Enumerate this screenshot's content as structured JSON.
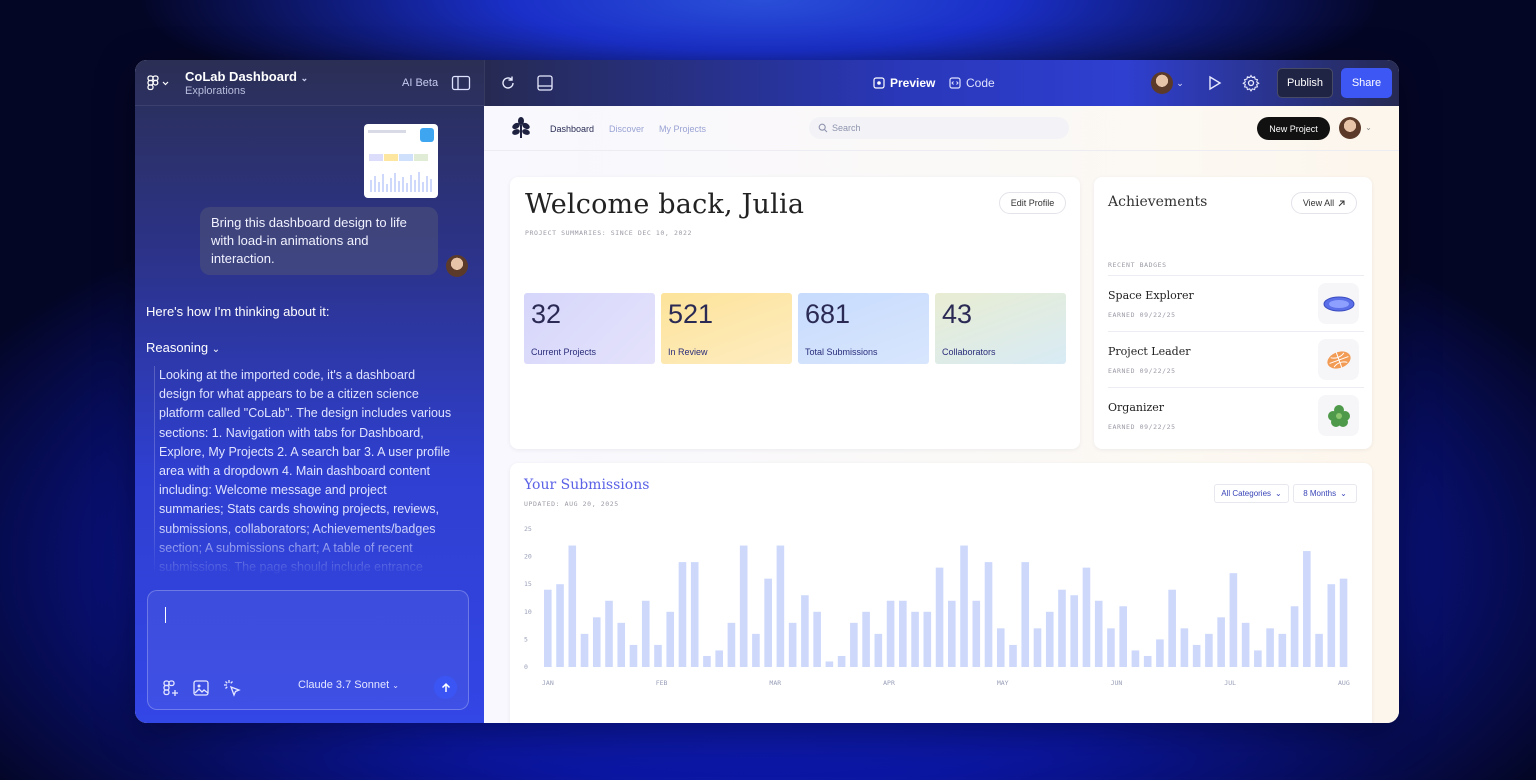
{
  "editor": {
    "project_title": "CoLab Dashboard",
    "project_subtitle": "Explorations",
    "ai_beta": "AI Beta",
    "tabs": {
      "preview": "Preview",
      "code": "Code"
    },
    "publish": "Publish",
    "share": "Share"
  },
  "chat": {
    "user_message": "Bring this dashboard design to life with load-in animations and interaction.",
    "assistant_intro": "Here's how I'm thinking about it:",
    "reasoning_label": "Reasoning",
    "reasoning_text": "Looking at the imported code, it's a dashboard design for what appears to be a citizen science platform called \"CoLab\". The design includes various sections: 1. Navigation with tabs for Dashboard, Explore, My Projects 2. A search bar 3. A user profile area with a dropdown 4. Main dashboard content including: Welcome message and project summaries; Stats cards showing projects, reviews, submissions, collaborators; Achievements/badges section; A submissions chart; A table of recent submissions. The page should include entrance animations and interactive states.",
    "model": "Claude 3.7 Sonnet"
  },
  "preview": {
    "nav": {
      "dashboard": "Dashboard",
      "discover": "Discover",
      "my_projects": "My Projects"
    },
    "search_placeholder": "Search",
    "new_project": "New Project",
    "welcome": "Welcome back, Julia",
    "summary_caption": "PROJECT SUMMARIES: SINCE DEC 10, 2022",
    "edit_profile": "Edit Profile",
    "stats": [
      {
        "value": "32",
        "label": "Current Projects"
      },
      {
        "value": "521",
        "label": "In Review"
      },
      {
        "value": "681",
        "label": "Total Submissions"
      },
      {
        "value": "43",
        "label": "Collaborators"
      }
    ],
    "achievements": {
      "title": "Achievements",
      "view_all": "View All",
      "recent_label": "RECENT BADGES",
      "badges": [
        {
          "name": "Space Explorer",
          "earned": "EARNED 09/22/25"
        },
        {
          "name": "Project Leader",
          "earned": "EARNED 09/22/25"
        },
        {
          "name": "Organizer",
          "earned": "EARNED 09/22/25"
        }
      ]
    },
    "submissions": {
      "title": "Your Submissions",
      "updated": "UPDATED: AUG 20, 2025",
      "category_filter": "All Categories",
      "range_filter": "8 Months"
    }
  },
  "chart_data": {
    "type": "bar",
    "ylim": [
      0,
      25
    ],
    "yticks": [
      "25",
      "20",
      "15",
      "10",
      "5",
      "0"
    ],
    "xticks": [
      "JAN",
      "FEB",
      "MAR",
      "APR",
      "MAY",
      "JUN",
      "JUL",
      "AUG"
    ],
    "values": [
      14,
      15,
      22,
      6,
      9,
      12,
      8,
      4,
      12,
      4,
      10,
      19,
      19,
      2,
      3,
      8,
      22,
      6,
      16,
      22,
      8,
      13,
      10,
      1,
      2,
      8,
      10,
      6,
      12,
      12,
      10,
      10,
      18,
      12,
      22,
      12,
      19,
      7,
      4,
      19,
      7,
      10,
      14,
      13,
      18,
      12,
      7,
      11,
      3,
      2,
      5,
      14,
      7,
      4,
      6,
      9,
      17,
      8,
      3,
      7,
      6,
      11,
      21,
      6,
      15,
      16
    ],
    "color": "#cdd8fb"
  },
  "colors": {
    "accent": "#3d57f5",
    "stat_purple": "#dcdcfb",
    "stat_yellow": "#fde7a0",
    "stat_blue": "#cfe0fd",
    "stat_green": "#e1ecd6"
  }
}
